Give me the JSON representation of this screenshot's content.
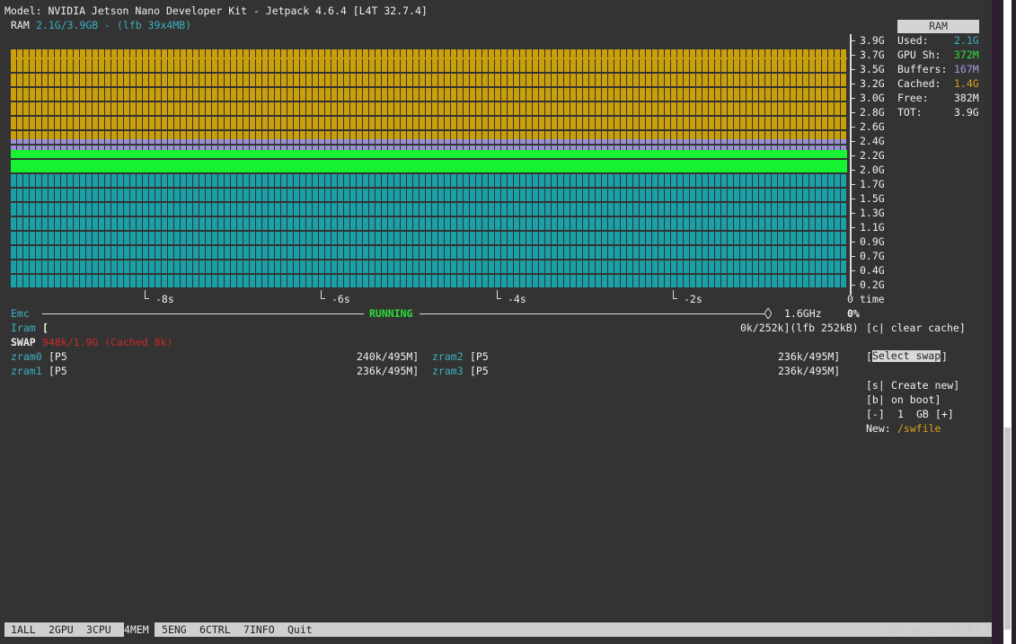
{
  "header": {
    "model_line": "Model: NVIDIA Jetson Nano Developer Kit - Jetpack 4.6.4 [L4T 32.7.4]",
    "ram_label": "RAM ",
    "ram_value": "2.1G/3.9GB - (lfb 39x4MB)"
  },
  "ram_panel": {
    "title": "RAM",
    "rows": [
      {
        "label": "Used:",
        "value": "2.1G",
        "color": "#3ab0c0"
      },
      {
        "label": "GPU Sh:",
        "value": "372M",
        "color": "#2ddc3a"
      },
      {
        "label": "Buffers:",
        "value": "167M",
        "color": "#a499e0"
      },
      {
        "label": "Cached:",
        "value": "1.4G",
        "color": "#d6a21e"
      },
      {
        "label": "Free:",
        "value": "382M",
        "color": "#f0f0f0"
      },
      {
        "label": "TOT:",
        "value": "3.9G",
        "color": "#f0f0f0"
      }
    ]
  },
  "chart_data": {
    "type": "area",
    "title": "",
    "ylabel": "",
    "xlabel": "time",
    "y_ticks": [
      "3.9G",
      "3.7G",
      "3.5G",
      "3.2G",
      "3.0G",
      "2.8G",
      "2.6G",
      "2.4G",
      "2.2G",
      "2.0G",
      "1.7G",
      "1.5G",
      "1.3G",
      "1.1G",
      "0.9G",
      "0.7G",
      "0.4G",
      "0.2G"
    ],
    "x_ticks": [
      "-8s",
      "-6s",
      "-4s",
      "-2s",
      "0"
    ],
    "ylim": [
      0,
      3.9
    ],
    "series": [
      {
        "name": "Used",
        "value": 1.8,
        "color": "#1aa0a6"
      },
      {
        "name": "GPU Sh",
        "value": 0.372,
        "color": "#16f232"
      },
      {
        "name": "Buffers",
        "value": 0.167,
        "color": "#9890d2"
      },
      {
        "name": "Cached",
        "value": 1.4,
        "color": "#c99f0c"
      }
    ]
  },
  "emc": {
    "label": "Emc",
    "status": "RUNNING",
    "freq": "1.6GHz",
    "percent": "0%"
  },
  "iram": {
    "label": "Iram",
    "bracket": "[",
    "value": "0k/252k](lfb 252kB)",
    "clear_cache": "[c| clear cache]"
  },
  "swap": {
    "label": "SWAP",
    "value": "948k/1.9G (Cached 8k)",
    "zrams": [
      {
        "name": "zram0",
        "prio": "[P5",
        "usage": "240k/495M]"
      },
      {
        "name": "zram1",
        "prio": "[P5",
        "usage": "236k/495M]"
      },
      {
        "name": "zram2",
        "prio": "[P5",
        "usage": "236k/495M]"
      },
      {
        "name": "zram3",
        "prio": "[P5",
        "usage": "236k/495M]"
      }
    ]
  },
  "swap_controls": {
    "select_swap": "Select swap",
    "create_new_key": "[s|",
    "create_new": "Create new]",
    "on_boot_key": "[b|",
    "on_boot": "on boot]",
    "size_minus": "[-]",
    "size_value": "1",
    "size_unit": "GB",
    "size_plus": "[+]",
    "new_label": "New:",
    "new_value": "/swfile"
  },
  "tabs": [
    {
      "key": "1",
      "label": "ALL"
    },
    {
      "key": "2",
      "label": "GPU"
    },
    {
      "key": "3",
      "label": "CPU"
    },
    {
      "key": "4",
      "label": "MEM",
      "active": true
    },
    {
      "key": "5",
      "label": "ENG"
    },
    {
      "key": "6",
      "label": "CTRL"
    },
    {
      "key": "7",
      "label": "INFO"
    },
    {
      "key": "",
      "label": "Quit"
    }
  ],
  "watermark": "CSDN @FC2024C(R) X"
}
